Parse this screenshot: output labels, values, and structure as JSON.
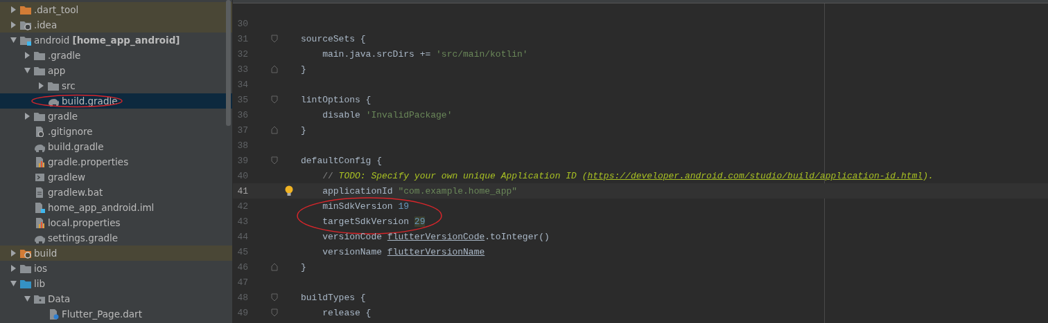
{
  "project_tree": [
    {
      "name": ".dart_tool",
      "kind": "excluded-folder",
      "expanded": false,
      "excluded": true,
      "selected": false
    },
    {
      "name": ".idea",
      "kind": "settings-folder",
      "expanded": false,
      "excluded": true,
      "selected": false
    },
    {
      "name": "android **[home_app_android]**",
      "kind": "module",
      "expanded": true,
      "excluded": false,
      "selected": false,
      "children": [
        {
          "name": ".gradle",
          "kind": "folder",
          "expanded": false,
          "excluded": false,
          "selected": false
        },
        {
          "name": "app",
          "kind": "folder",
          "expanded": true,
          "excluded": false,
          "selected": false,
          "children": [
            {
              "name": "src",
              "kind": "folder",
              "expanded": false,
              "excluded": false,
              "selected": false
            },
            {
              "name": "build.gradle",
              "kind": "gradle",
              "excluded": false,
              "selected": true,
              "circled": true
            }
          ]
        },
        {
          "name": "gradle",
          "kind": "folder",
          "expanded": false,
          "excluded": false,
          "selected": false
        },
        {
          "name": ".gitignore",
          "kind": "ignore-file",
          "excluded": false,
          "selected": false
        },
        {
          "name": "build.gradle",
          "kind": "gradle",
          "excluded": false,
          "selected": false
        },
        {
          "name": "gradle.properties",
          "kind": "properties",
          "excluded": false,
          "selected": false
        },
        {
          "name": "gradlew",
          "kind": "shell",
          "excluded": false,
          "selected": false
        },
        {
          "name": "gradlew.bat",
          "kind": "text",
          "excluded": false,
          "selected": false
        },
        {
          "name": "home_app_android.iml",
          "kind": "module-file",
          "excluded": false,
          "selected": false
        },
        {
          "name": "local.properties",
          "kind": "properties",
          "excluded": false,
          "selected": false
        },
        {
          "name": "settings.gradle",
          "kind": "gradle",
          "excluded": false,
          "selected": false
        }
      ]
    },
    {
      "name": "build",
      "kind": "excluded-settings-folder",
      "expanded": false,
      "excluded": true,
      "selected": false
    },
    {
      "name": "ios",
      "kind": "folder",
      "expanded": false,
      "excluded": false,
      "selected": false
    },
    {
      "name": "lib",
      "kind": "source-folder",
      "expanded": true,
      "excluded": false,
      "selected": false,
      "children": [
        {
          "name": "Data",
          "kind": "package",
          "expanded": true,
          "excluded": false,
          "selected": false,
          "children": [
            {
              "name": "Flutter_Page.dart",
              "kind": "dart",
              "excluded": false,
              "selected": false
            }
          ]
        }
      ]
    }
  ],
  "editor": {
    "lines": [
      {
        "number": "30",
        "current": false
      },
      {
        "number": "31",
        "current": false,
        "fold_open": true,
        "tokens": [
          {
            "t": "sourceSets {",
            "kind": "plain"
          }
        ]
      },
      {
        "number": "32",
        "current": false,
        "tokens": [
          {
            "t": "    main.java.srcDirs += ",
            "kind": "plain"
          },
          {
            "t": "'src/main/kotlin'",
            "kind": "string"
          }
        ]
      },
      {
        "number": "33",
        "current": false,
        "fold_close": true,
        "tokens": [
          {
            "t": "}",
            "kind": "plain"
          }
        ]
      },
      {
        "number": "34",
        "current": false
      },
      {
        "number": "35",
        "current": false,
        "fold_open": true,
        "tokens": [
          {
            "t": "lintOptions {",
            "kind": "plain"
          }
        ]
      },
      {
        "number": "36",
        "current": false,
        "tokens": [
          {
            "t": "    disable ",
            "kind": "plain"
          },
          {
            "t": "'InvalidPackage'",
            "kind": "string"
          }
        ]
      },
      {
        "number": "37",
        "current": false,
        "fold_close": true,
        "tokens": [
          {
            "t": "}",
            "kind": "plain"
          }
        ]
      },
      {
        "number": "38",
        "current": false
      },
      {
        "number": "39",
        "current": false,
        "fold_open": true,
        "tokens": [
          {
            "t": "defaultConfig {",
            "kind": "plain"
          }
        ]
      },
      {
        "number": "40",
        "current": false,
        "tokens": [
          {
            "t": "    // ",
            "kind": "comment"
          },
          {
            "t": "TODO: Specify your own unique Application ID (",
            "kind": "todo"
          },
          {
            "t": "https://developer.android.com/studio/build/application-id.html",
            "kind": "link"
          },
          {
            "t": ").",
            "kind": "todo"
          }
        ]
      },
      {
        "number": "41",
        "current": true,
        "bulb": true,
        "tokens": [
          {
            "t": "    applicationId ",
            "kind": "plain"
          },
          {
            "t": "\"com.example.home_app\"",
            "kind": "string"
          }
        ]
      },
      {
        "number": "42",
        "current": false,
        "tokens": [
          {
            "t": "    minSdkVersion ",
            "kind": "plain"
          },
          {
            "t": "19",
            "kind": "number"
          }
        ]
      },
      {
        "number": "43",
        "current": false,
        "circled": true,
        "tokens": [
          {
            "t": "    targetSdkVersion ",
            "kind": "plain"
          },
          {
            "t": "29",
            "kind": "number-marked"
          }
        ]
      },
      {
        "number": "44",
        "current": false,
        "tokens": [
          {
            "t": "    versionCode ",
            "kind": "plain"
          },
          {
            "t": "flutterVersionCode",
            "kind": "ref"
          },
          {
            "t": ".toInteger()",
            "kind": "plain"
          }
        ]
      },
      {
        "number": "45",
        "current": false,
        "tokens": [
          {
            "t": "    versionName ",
            "kind": "plain"
          },
          {
            "t": "flutterVersionName",
            "kind": "ref"
          }
        ]
      },
      {
        "number": "46",
        "current": false,
        "fold_close": true,
        "tokens": [
          {
            "t": "}",
            "kind": "plain"
          }
        ]
      },
      {
        "number": "47",
        "current": false
      },
      {
        "number": "48",
        "current": false,
        "fold_open": true,
        "tokens": [
          {
            "t": "buildTypes {",
            "kind": "plain"
          }
        ]
      },
      {
        "number": "49",
        "current": false,
        "fold_open": true,
        "tokens": [
          {
            "t": "    release {",
            "kind": "plain"
          }
        ]
      }
    ]
  }
}
